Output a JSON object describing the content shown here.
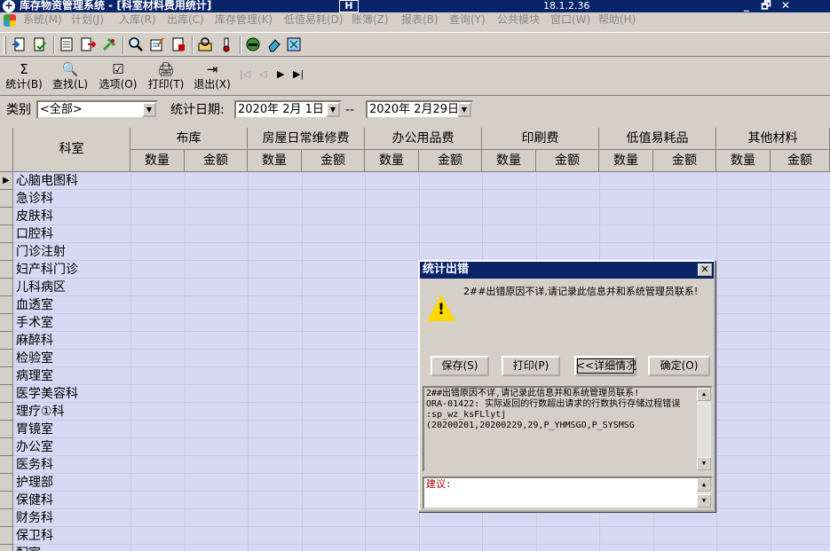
{
  "titlebar": {
    "title": "库存物资管理系统 - [科室材料费用统计]",
    "version": "18.1.2.36",
    "minimize": "_",
    "restore": "🗗",
    "close": "✕"
  },
  "menubar": {
    "items": [
      "系统(M)",
      "计划(J)",
      "入库(R)",
      "出库(C)",
      "库存管理(K)",
      "低值易耗(D)",
      "账簿(Z)",
      "报表(B)",
      "查询(Y)",
      "公共模块",
      "窗口(W)",
      "帮助(H)"
    ]
  },
  "toolbar2": {
    "buttons": [
      {
        "icon": "Σ",
        "label": "统计(B)"
      },
      {
        "icon": "🔍",
        "label": "查找(L)"
      },
      {
        "icon": "☑",
        "label": "选项(O)"
      },
      {
        "icon": "🖨",
        "label": "打印(T)"
      },
      {
        "icon": "⇥",
        "label": "退出(X)"
      }
    ],
    "nav": [
      "|◁",
      "◁",
      "▶",
      "▶|"
    ]
  },
  "filters": {
    "category_label": "类别",
    "category_value": "<全部>",
    "date_label": "统计日期:",
    "start_date": "2020年 2月 1日",
    "separator": "--",
    "end_date": "2020年 2月29日"
  },
  "grid": {
    "first_col": "科室",
    "groups": [
      "布库",
      "房屋日常维修费",
      "办公用品费",
      "印刷费",
      "低值易耗品",
      "其他材料"
    ],
    "sub_qty": "数量",
    "sub_amount": "金额",
    "row_indicator": "▶",
    "rows": [
      "心脑电图科",
      "急诊科",
      "皮肤科",
      "口腔科",
      "门诊注射",
      "妇产科门诊",
      "儿科病区",
      "血透室",
      "手术室",
      "麻醉科",
      "检验室",
      "病理室",
      "医学美容科",
      "理疗①科",
      "胃镜室",
      "办公室",
      "医务科",
      "护理部",
      "保健科",
      "财务科",
      "保卫科",
      "配室"
    ]
  },
  "dialog": {
    "title": "统计出错",
    "close": "✕",
    "message": "2##出错原因不详,请记录此信息并和系统管理员联系!",
    "buttons": [
      "保存(S)",
      "打印(P)",
      "<<详细情况",
      "确定(O)"
    ],
    "detail_text": "2##出错原因不详,请记录此信息并和系统管理员联系!\nORA-01422: 实际返回的行数超出请求的行数执行存储过程错误         :sp_wz_ksFLlytj\n(20200201,20200229,29,P_YHMSGO,P_SYSMSG",
    "suggestion_label": "建议:",
    "scroll_up": "▲",
    "scroll_down": "▼"
  }
}
